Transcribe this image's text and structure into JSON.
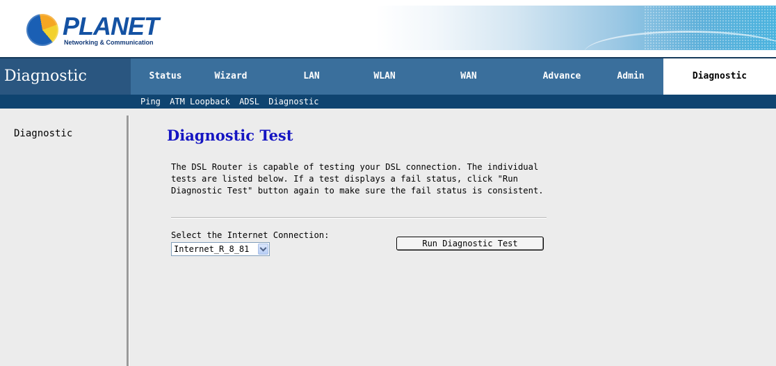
{
  "brand": {
    "name": "PLANET",
    "tagline": "Networking & Communication"
  },
  "nav": {
    "section_title": "Diagnostic",
    "tabs": [
      {
        "label": "Status"
      },
      {
        "label": "Wizard"
      },
      {
        "label": "LAN"
      },
      {
        "label": "WLAN"
      },
      {
        "label": "WAN"
      },
      {
        "label": "Advance"
      },
      {
        "label": "Admin"
      },
      {
        "label": "Diagnostic",
        "active": true
      }
    ],
    "sub_tabs": [
      "Ping",
      "ATM Loopback",
      "ADSL",
      "Diagnostic"
    ]
  },
  "sidebar": {
    "items": [
      {
        "label": "Diagnostic"
      }
    ]
  },
  "main": {
    "title": "Diagnostic Test",
    "description": "The DSL Router is capable of testing your DSL connection. The individual tests are listed below. If a test displays a fail status, click \"Run Diagnostic Test\" button again to make sure the fail status is consistent.",
    "select_label": "Select the Internet Connection:",
    "select_value": "Internet_R_8_81",
    "run_button": "Run Diagnostic Test"
  },
  "colors": {
    "nav_bg": "#3a6f9c",
    "sub_nav_bg": "#0f4470",
    "title_blue": "#1515c2",
    "content_bg": "#ececec"
  }
}
